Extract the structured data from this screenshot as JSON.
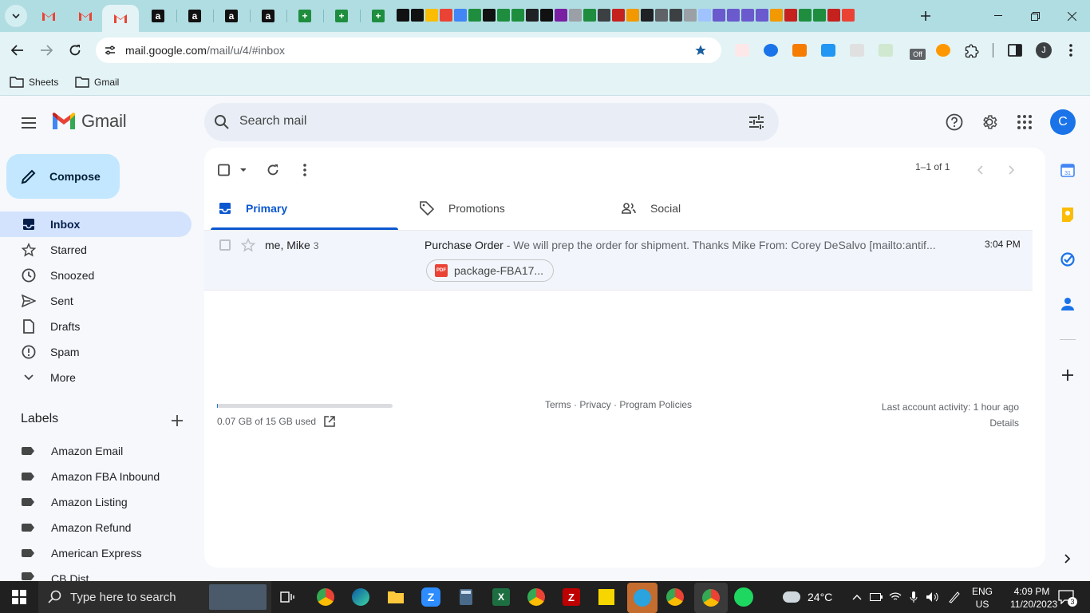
{
  "browser": {
    "url_host": "mail.google.com",
    "url_path": "/mail/u/4/#inbox",
    "bookmarks": [
      {
        "label": "Sheets"
      },
      {
        "label": "Gmail"
      }
    ],
    "profile_initial": "J",
    "extension_badge": "Off"
  },
  "gmail": {
    "logo_text": "Gmail",
    "search_placeholder": "Search mail",
    "avatar_initial": "C",
    "compose_label": "Compose",
    "nav": [
      {
        "label": "Inbox",
        "icon": "inbox-icon",
        "active": true
      },
      {
        "label": "Starred",
        "icon": "star-icon"
      },
      {
        "label": "Snoozed",
        "icon": "clock-icon"
      },
      {
        "label": "Sent",
        "icon": "send-icon"
      },
      {
        "label": "Drafts",
        "icon": "draft-icon"
      },
      {
        "label": "Spam",
        "icon": "spam-icon"
      },
      {
        "label": "More",
        "icon": "chevron-down-icon"
      }
    ],
    "labels_heading": "Labels",
    "labels": [
      {
        "label": "Amazon Email"
      },
      {
        "label": "Amazon FBA Inbound"
      },
      {
        "label": "Amazon Listing"
      },
      {
        "label": "Amazon Refund"
      },
      {
        "label": "American Express"
      },
      {
        "label": "CB Dist"
      }
    ],
    "pager": "1–1 of 1",
    "tabs": [
      {
        "label": "Primary",
        "active": true
      },
      {
        "label": "Promotions"
      },
      {
        "label": "Social"
      }
    ],
    "emails": [
      {
        "sender": "me, Mike",
        "count": "3",
        "subject": "Purchase Order",
        "snippet": " - We will prep the order for shipment. Thanks Mike From: Corey DeSalvo [mailto:antif...",
        "time": "3:04 PM",
        "attachment": "package-FBA17..."
      }
    ],
    "storage_text": "0.07 GB of 15 GB used",
    "storage_fraction": 0.005,
    "footer_links": "Terms · Privacy · Program Policies",
    "last_activity": "Last account activity: 1 hour ago",
    "details": "Details"
  },
  "taskbar": {
    "search_placeholder": "Type here to search",
    "temperature": "24°C",
    "lang1": "ENG",
    "lang2": "US",
    "time": "4:09 PM",
    "date": "11/20/2023",
    "notifications": "3"
  },
  "colors": {
    "chrome_tab_strip": "#b0dde2",
    "chrome_toolbar": "#e4f3f5",
    "gmail_bg": "#f6f8fc",
    "accent_blue": "#0b57d0",
    "compose_bg": "#c2e7ff",
    "active_nav": "#d3e3fd"
  }
}
